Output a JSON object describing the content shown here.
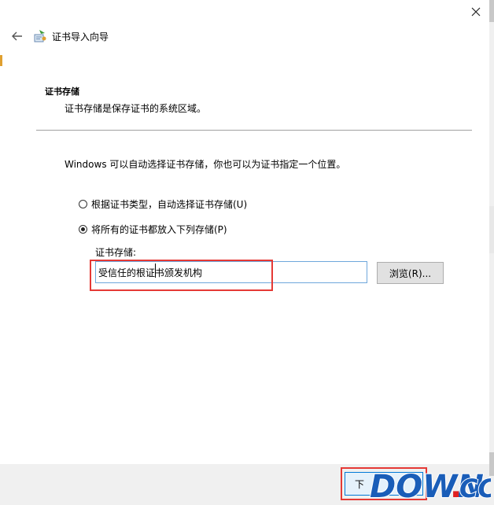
{
  "wizard": {
    "title": "证书导入向导"
  },
  "section": {
    "heading": "证书存储",
    "description": "证书存储是保存证书的系统区域。"
  },
  "intro": "Windows 可以自动选择证书存储，你也可以为证书指定一个位置。",
  "options": [
    {
      "label": "根据证书类型，自动选择证书存储(U)",
      "selected": false
    },
    {
      "label": "将所有的证书都放入下列存储(P)",
      "selected": true
    }
  ],
  "store": {
    "label": "证书存储:",
    "value": "受信任的根证书颁发机构"
  },
  "buttons": {
    "browse": "浏览(R)...",
    "next": "下"
  },
  "watermark": {
    "text_main": "DOWN",
    "text_dot": ".",
    "text_cc": "CC"
  },
  "colors": {
    "highlight": "#e53935",
    "input_border": "#6fa8dc",
    "watermark_blue": "#1a5db8",
    "watermark_red": "#e02020"
  },
  "icons": {
    "close": "close-icon",
    "back": "back-arrow-icon",
    "wizard": "certificate-wizard-icon"
  }
}
